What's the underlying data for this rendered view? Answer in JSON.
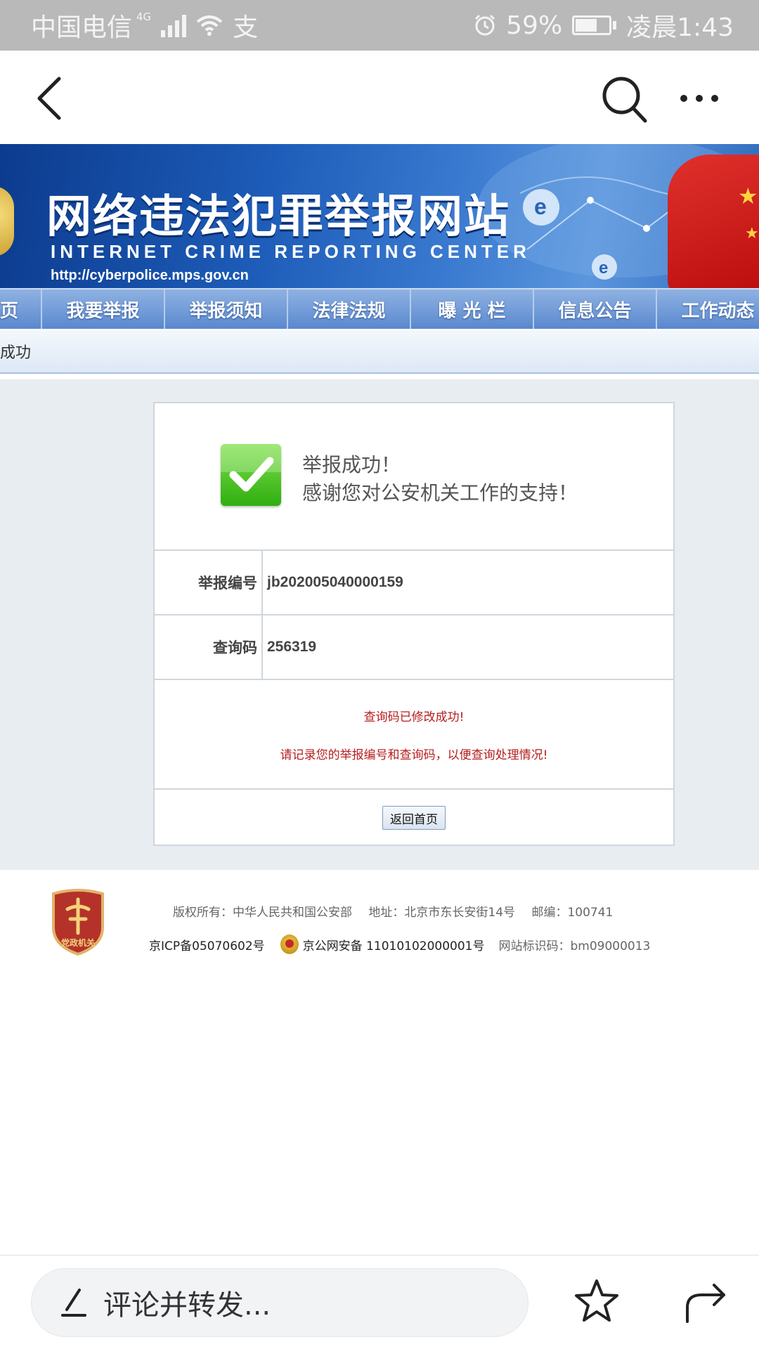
{
  "status_bar": {
    "carrier": "中国电信",
    "network": "4G",
    "app_badge": "支",
    "battery": "59%",
    "time": "凌晨1:43"
  },
  "banner": {
    "title": "网络违法犯罪举报网站",
    "subtitle": "INTERNET CRIME REPORTING CENTER",
    "url": "http://cyberpolice.mps.gov.cn"
  },
  "menu": {
    "items": [
      "页",
      "我要举报",
      "举报须知",
      "法律法规",
      "曝 光 栏",
      "信息公告",
      "工作动态"
    ]
  },
  "breadcrumb": "成功",
  "success": {
    "line1": "举报成功！",
    "line2": "感谢您对公安机关工作的支持！"
  },
  "report": {
    "number_label": "举报编号",
    "number_value": "jb202005040000159",
    "code_label": "查询码",
    "code_value": "256319"
  },
  "notice": {
    "line1": "查询码已修改成功!",
    "line2": "请记录您的举报编号和查询码，以便查询处理情况!"
  },
  "home_button": "返回首页",
  "footer": {
    "copyright": "版权所有：中华人民共和国公安部",
    "address": "地址：北京市东长安街14号",
    "postcode": "邮编：100741",
    "icp": "京ICP备05070602号",
    "police_record": "京公网安备 11010102000001号",
    "site_code": "网站标识码：bm09000013",
    "badge_text": "党政机关"
  },
  "bottom_bar": {
    "comment_placeholder": "评论并转发..."
  },
  "colors": {
    "notice_red": "#b71c1c",
    "banner_blue": "#1d5cb8",
    "status_bar_gray": "#b9b9b9"
  }
}
